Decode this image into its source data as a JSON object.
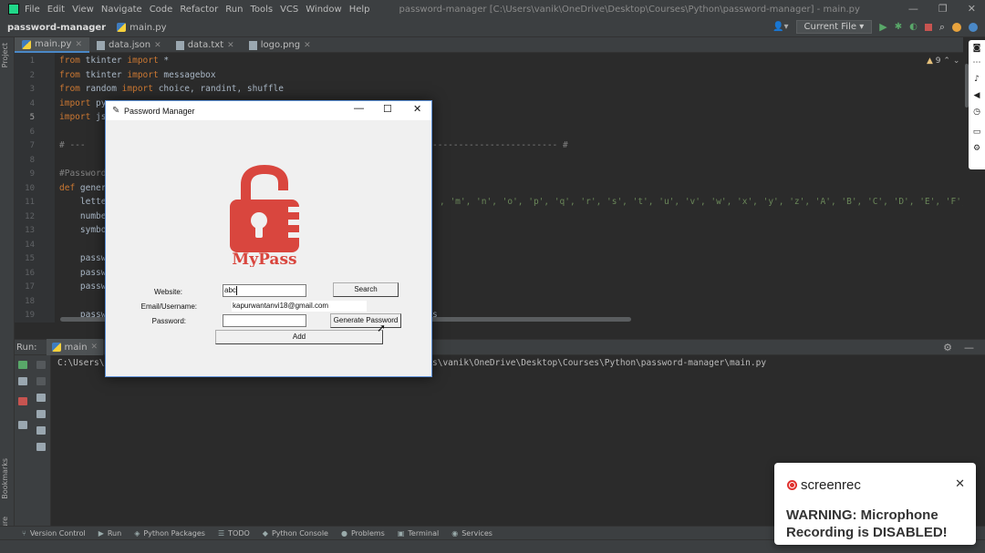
{
  "ide": {
    "menu": [
      "File",
      "Edit",
      "View",
      "Navigate",
      "Code",
      "Refactor",
      "Run",
      "Tools",
      "VCS",
      "Window",
      "Help"
    ],
    "window_title": "password-manager [C:\\Users\\vanik\\OneDrive\\Desktop\\Courses\\Python\\password-manager] - main.py",
    "project_name": "password-manager",
    "breadcrumb_file": "main.py",
    "run_config": "Current File",
    "tabs": [
      "main.py",
      "data.json",
      "data.txt",
      "logo.png"
    ],
    "warnings_count": "9",
    "line_numbers": [
      "1",
      "2",
      "3",
      "4",
      "5",
      "6",
      "7",
      "8",
      "9",
      "10",
      "11",
      "12",
      "13",
      "14",
      "15",
      "16",
      "17",
      "18",
      "19"
    ],
    "code": {
      "l1_kw1": "from",
      "l1_mod": " tkinter ",
      "l1_kw2": "import",
      "l1_rest": " *",
      "l2_kw1": "from",
      "l2_mod": " tkinter ",
      "l2_kw2": "import",
      "l2_rest": " messagebox",
      "l3_kw1": "from",
      "l3_mod": " random ",
      "l3_kw2": "import",
      "l3_rest": " choice, randint, shuffle",
      "l4_kw1": "import",
      "l4_rest": " py",
      "l5_kw1": "import",
      "l5_rest": " js",
      "l7": "# ---",
      "l7_right": "------------------------ #",
      "l9": "#Password",
      "l10_kw": "def",
      "l10_rest": " gener",
      "l11": "    lette",
      "l11_right": ", 'm', 'n', 'o', 'p', 'q', 'r', 's', 't', 'u', 'v', 'w', 'x', 'y', 'z', 'A', 'B', 'C', 'D', 'E', 'F', 'G'",
      "l12": "    numbe",
      "l13": "    symbo",
      "l15": "    passw",
      "l16": "    passw",
      "l17": "    passw",
      "l19": "    passw",
      "l19_right": "s"
    },
    "run": {
      "label": "Run:",
      "tab": "main",
      "console_left": "C:\\Users\\",
      "console_right": "s\\vanik\\OneDrive\\Desktop\\Courses\\Python\\password-manager\\main.py"
    },
    "side_labels": {
      "project": "Project",
      "bookmarks": "Bookmarks",
      "structure": "Structure"
    },
    "bottom_tools": [
      "Version Control",
      "Run",
      "Python Packages",
      "TODO",
      "Python Console",
      "Problems",
      "Terminal",
      "Services"
    ]
  },
  "dialog": {
    "title": "Password Manager",
    "logo_text": "MyPass",
    "website_label": "Website:",
    "website_value": "abc",
    "search_button": "Search",
    "email_label": "Email/Username:",
    "email_value": "kapurwantanvi18@gmail.com",
    "password_label": "Password:",
    "password_value": "",
    "generate_button": "Generate Password",
    "add_button": "Add"
  },
  "toast": {
    "brand": "screenrec",
    "message": "WARNING: Microphone Recording is DISABLED!"
  },
  "colors": {
    "logo_red": "#d9463e",
    "keyword": "#cc7832",
    "accent_blue": "#4a88c7",
    "rec_red": "#e0312e"
  }
}
